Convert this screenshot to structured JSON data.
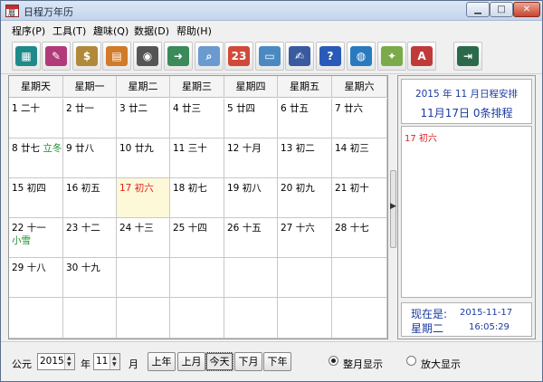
{
  "window": {
    "title": "日程万年历",
    "icon_text": "曆"
  },
  "menu": [
    "程序(P)",
    "工具(T)",
    "趣味(Q)",
    "数据(D)",
    "帮助(H)"
  ],
  "toolbar": [
    {
      "name": "keyboard-icon",
      "bg": "#1f8a8a",
      "glyph": "▦"
    },
    {
      "name": "notebook-pen-icon",
      "bg": "#b23a7a",
      "glyph": "✎"
    },
    {
      "name": "money-bag-icon",
      "bg": "#b08a3a",
      "glyph": "$"
    },
    {
      "name": "address-book-icon",
      "bg": "#d07a2a",
      "glyph": "▤"
    },
    {
      "name": "film-reel-icon",
      "bg": "#555555",
      "glyph": "◉"
    },
    {
      "name": "export-arrow-icon",
      "bg": "#3a8a5a",
      "glyph": "➜"
    },
    {
      "name": "magnifier-icon",
      "bg": "#6a9ad0",
      "glyph": "⌕"
    },
    {
      "name": "calendar-page-icon",
      "bg": "#d04a3a",
      "glyph": "23"
    },
    {
      "name": "monitor-icon",
      "bg": "#4a8ac0",
      "glyph": "▭"
    },
    {
      "name": "edit-note-icon",
      "bg": "#3a5aa0",
      "glyph": "✍"
    },
    {
      "name": "help-icon",
      "bg": "#2a5ab8",
      "glyph": "?"
    },
    {
      "name": "globe-icon",
      "bg": "#2a7ac0",
      "glyph": "◍"
    },
    {
      "name": "paint-brush-icon",
      "bg": "#7aaa4a",
      "glyph": "✦"
    },
    {
      "name": "font-icon",
      "bg": "#c03a3a",
      "glyph": "A"
    },
    {
      "name": "exit-door-icon",
      "bg": "#2a6a4a",
      "glyph": "⇥"
    }
  ],
  "calendar": {
    "headers": [
      "星期天",
      "星期一",
      "星期二",
      "星期三",
      "星期四",
      "星期五",
      "星期六"
    ],
    "today_color": "#e02020",
    "term_color": "#1a8a2a",
    "weeks": [
      [
        {
          "d": "1",
          "l": "二十"
        },
        {
          "d": "2",
          "l": "廿一"
        },
        {
          "d": "3",
          "l": "廿二"
        },
        {
          "d": "4",
          "l": "廿三"
        },
        {
          "d": "5",
          "l": "廿四"
        },
        {
          "d": "6",
          "l": "廿五"
        },
        {
          "d": "7",
          "l": "廿六"
        }
      ],
      [
        {
          "d": "8",
          "l": "廿七",
          "t": "立冬"
        },
        {
          "d": "9",
          "l": "廿八"
        },
        {
          "d": "10",
          "l": "廿九"
        },
        {
          "d": "11",
          "l": "三十"
        },
        {
          "d": "12",
          "l": "十月"
        },
        {
          "d": "13",
          "l": "初二"
        },
        {
          "d": "14",
          "l": "初三"
        }
      ],
      [
        {
          "d": "15",
          "l": "初四"
        },
        {
          "d": "16",
          "l": "初五"
        },
        {
          "d": "17",
          "l": "初六",
          "today": true
        },
        {
          "d": "18",
          "l": "初七"
        },
        {
          "d": "19",
          "l": "初八"
        },
        {
          "d": "20",
          "l": "初九"
        },
        {
          "d": "21",
          "l": "初十"
        }
      ],
      [
        {
          "d": "22",
          "l": "十一",
          "t2": "小雪"
        },
        {
          "d": "23",
          "l": "十二"
        },
        {
          "d": "24",
          "l": "十三"
        },
        {
          "d": "25",
          "l": "十四"
        },
        {
          "d": "26",
          "l": "十五"
        },
        {
          "d": "27",
          "l": "十六"
        },
        {
          "d": "28",
          "l": "十七"
        }
      ],
      [
        {
          "d": "29",
          "l": "十八"
        },
        {
          "d": "30",
          "l": "十九"
        },
        {},
        {},
        {},
        {},
        {}
      ],
      [
        {},
        {},
        {},
        {},
        {},
        {},
        {}
      ]
    ]
  },
  "right_panel": {
    "month_line": "2015 年 11 月日程安排",
    "day_line": "11月17日 0条排程",
    "list_item": "17 初六",
    "now_label": "现在是:",
    "now_date": "2015-11-17",
    "now_week": "星期二",
    "now_time": "16:05:29"
  },
  "bottom": {
    "era_label": "公元",
    "year": "2015",
    "year_unit": "年",
    "month": "11",
    "month_unit": "月",
    "buttons": [
      "上年",
      "上月",
      "今天",
      "下月",
      "下年"
    ],
    "radio_month": "整月显示",
    "radio_zoom": "放大显示"
  }
}
